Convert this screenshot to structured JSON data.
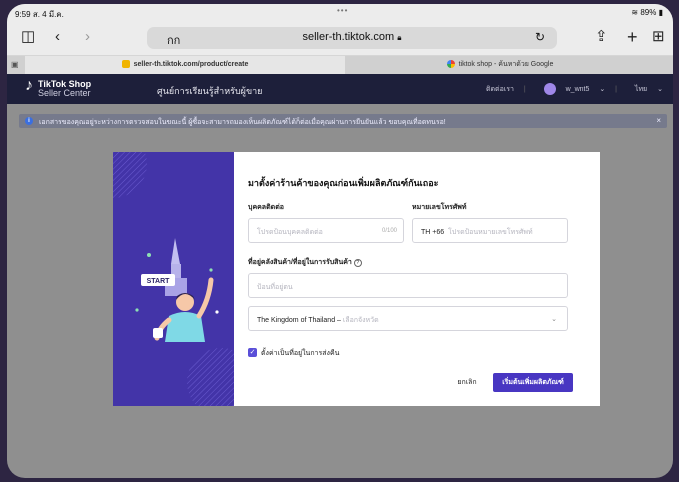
{
  "status_bar": {
    "time": "9:59",
    "date": "ส. 4 มี.ค.",
    "dots": "•••",
    "battery": "89%"
  },
  "toolbar": {
    "reader_label": "กก",
    "host": "seller-th.tiktok.com",
    "lock_icon": "lock-icon"
  },
  "tabs": [
    {
      "label": "seller-th.tiktok.com/product/create",
      "active": true
    },
    {
      "label": "tiktok shop - ค้นหาด้วย Google",
      "active": false
    }
  ],
  "header": {
    "brand_line1": "TikTok Shop",
    "brand_line2": "Seller Center",
    "academy": "ศูนย์การเรียนรู้สำหรับผู้ขาย",
    "contact": "ติดต่อเรา",
    "username": "w_wnt5",
    "language": "ไทย"
  },
  "notice": {
    "text": "เอกสารของคุณอยู่ระหว่างการตรวจสอบในขณะนี้ ผู้ซื้อจะสามารถมองเห็นผลิตภัณฑ์ได้ก็ต่อเมื่อคุณผ่านการยืนยันแล้ว ขอบคุณที่อดทนรอ!"
  },
  "modal": {
    "illustration_label": "START",
    "title": "มาตั้งค่าร้านค้าของคุณก่อนเพิ่มผลิตภัณฑ์กันเถอะ",
    "contact_label": "บุคคลติดต่อ",
    "contact_placeholder": "โปรดป้อนบุคคลติดต่อ",
    "contact_counter": "0/100",
    "phone_label": "หมายเลขโทรศัพท์",
    "phone_code": "TH +66",
    "phone_placeholder": "โปรดป้อนหมายเลขโทรศัพท์",
    "address_label": "ที่อยู่คลังสินค้า/ที่อยู่ในการรับสินค้า",
    "address_placeholder": "ป้อนที่อยู่ตน",
    "country": "The Kingdom of Thailand",
    "province_placeholder": "เลือกจังหวัด",
    "return_checkbox_label": "ตั้งค่าเป็นที่อยู่ในการส่งคืน",
    "return_checked": true,
    "cancel": "ยกเลิก",
    "start": "เริ่มต้นเพิ่มผลิตภัณฑ์"
  },
  "colors": {
    "header_bg": "#1d1f3a",
    "accent": "#4836c2",
    "illustration_bg": "#4334a8"
  }
}
